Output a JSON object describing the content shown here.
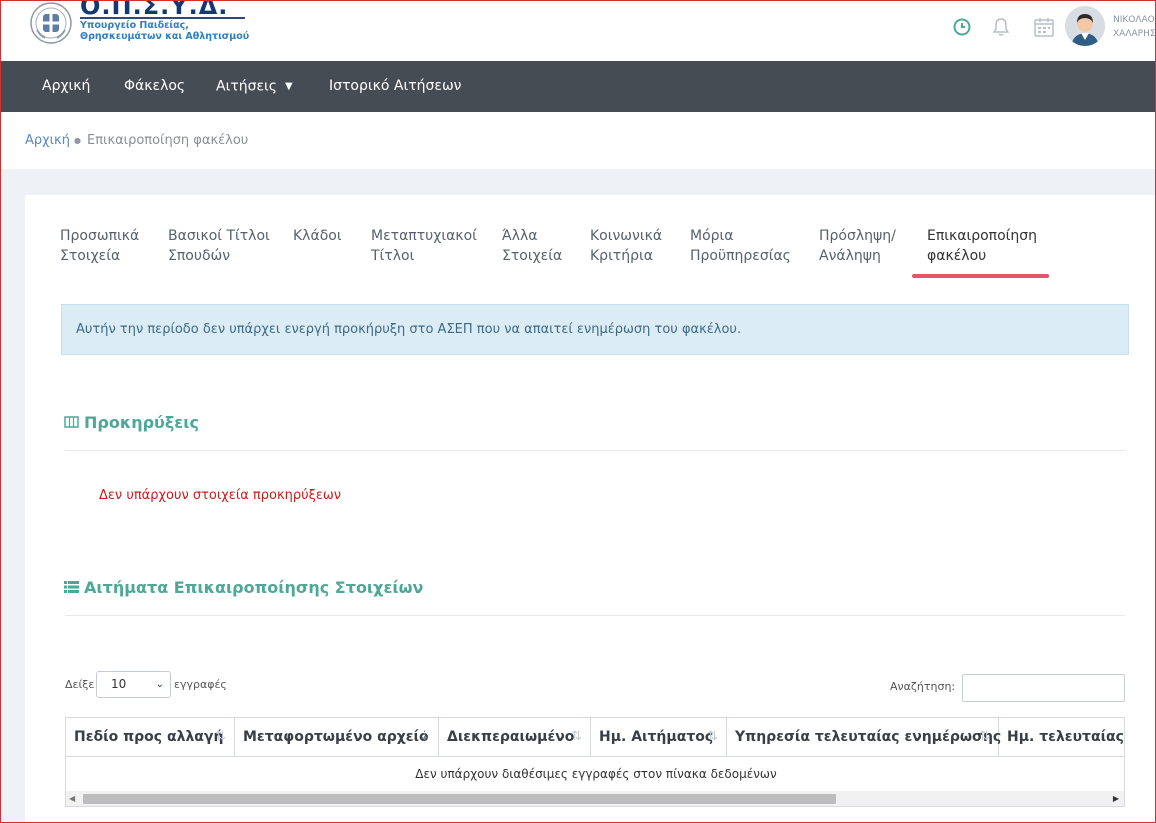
{
  "header": {
    "logo_title": "Ο.Π.Σ.Υ.Δ.",
    "logo_subtitle": "Υπουργείο Παιδείας, Θρησκευμάτων και Αθλητισμού",
    "user_name": "ΝΙΚΟΛΑΟΣ\nΧΑΛΑΡΗΣ",
    "icons": [
      "clock-icon",
      "bell-icon",
      "calendar-icon"
    ]
  },
  "nav": {
    "items": [
      {
        "label": "Αρχική"
      },
      {
        "label": "Φάκελος"
      },
      {
        "label": "Αιτήσεις",
        "dropdown": true
      },
      {
        "label": "Ιστορικό Αιτήσεων"
      }
    ]
  },
  "breadcrumb": {
    "home": "Αρχική",
    "separator": "●",
    "current": "Επικαιροποίηση φακέλου"
  },
  "tabs": [
    {
      "label": "Προσωπικά Στοιχεία"
    },
    {
      "label": "Βασικοί Τίτλοι Σπουδών"
    },
    {
      "label": "Κλάδοι"
    },
    {
      "label": "Μεταπτυχιακοί Τίτλοι"
    },
    {
      "label": "Άλλα Στοιχεία"
    },
    {
      "label": "Κοινωνικά Κριτήρια"
    },
    {
      "label": "Μόρια Προϋπηρεσίας"
    },
    {
      "label": "Πρόσληψη/ Ανάληψη"
    },
    {
      "label": "Επικαιροποίηση φακέλου",
      "active": true
    }
  ],
  "alert": {
    "text": "Αυτήν την περίοδο δεν υπάρχει ενεργή προκήρυξη στο ΑΣΕΠ που να απαιτεί ενημέρωση του φακέλου."
  },
  "announcements": {
    "title": "Προκηρύξεις",
    "empty_text": "Δεν υπάρχουν στοιχεία προκηρύξεων"
  },
  "requests": {
    "title": "Αιτήματα Επικαιροποίησης Στοιχείων",
    "show_label": "Δείξε",
    "page_size": "10",
    "records_label": "εγγραφές",
    "search_label": "Αναζήτηση:",
    "search_value": "",
    "columns": [
      "Πεδίο προς αλλαγή",
      "Μεταφορτωμένο αρχείο",
      "Διεκπεραιωμένο",
      "Ημ. Αιτήματος",
      "Υπηρεσία τελευταίας ενημέρωσης",
      "Ημ. τελευταίας ενημέρωσης"
    ],
    "empty_text": "Δεν υπάρχουν διαθέσιμες εγγραφές στον πίνακα δεδομένων"
  },
  "colors": {
    "nav_bg": "#464c54",
    "accent_teal": "#4ea897",
    "active_tab_underline": "#e5546b",
    "alert_bg": "#dbecf5",
    "error_red": "#cc1a1a"
  }
}
